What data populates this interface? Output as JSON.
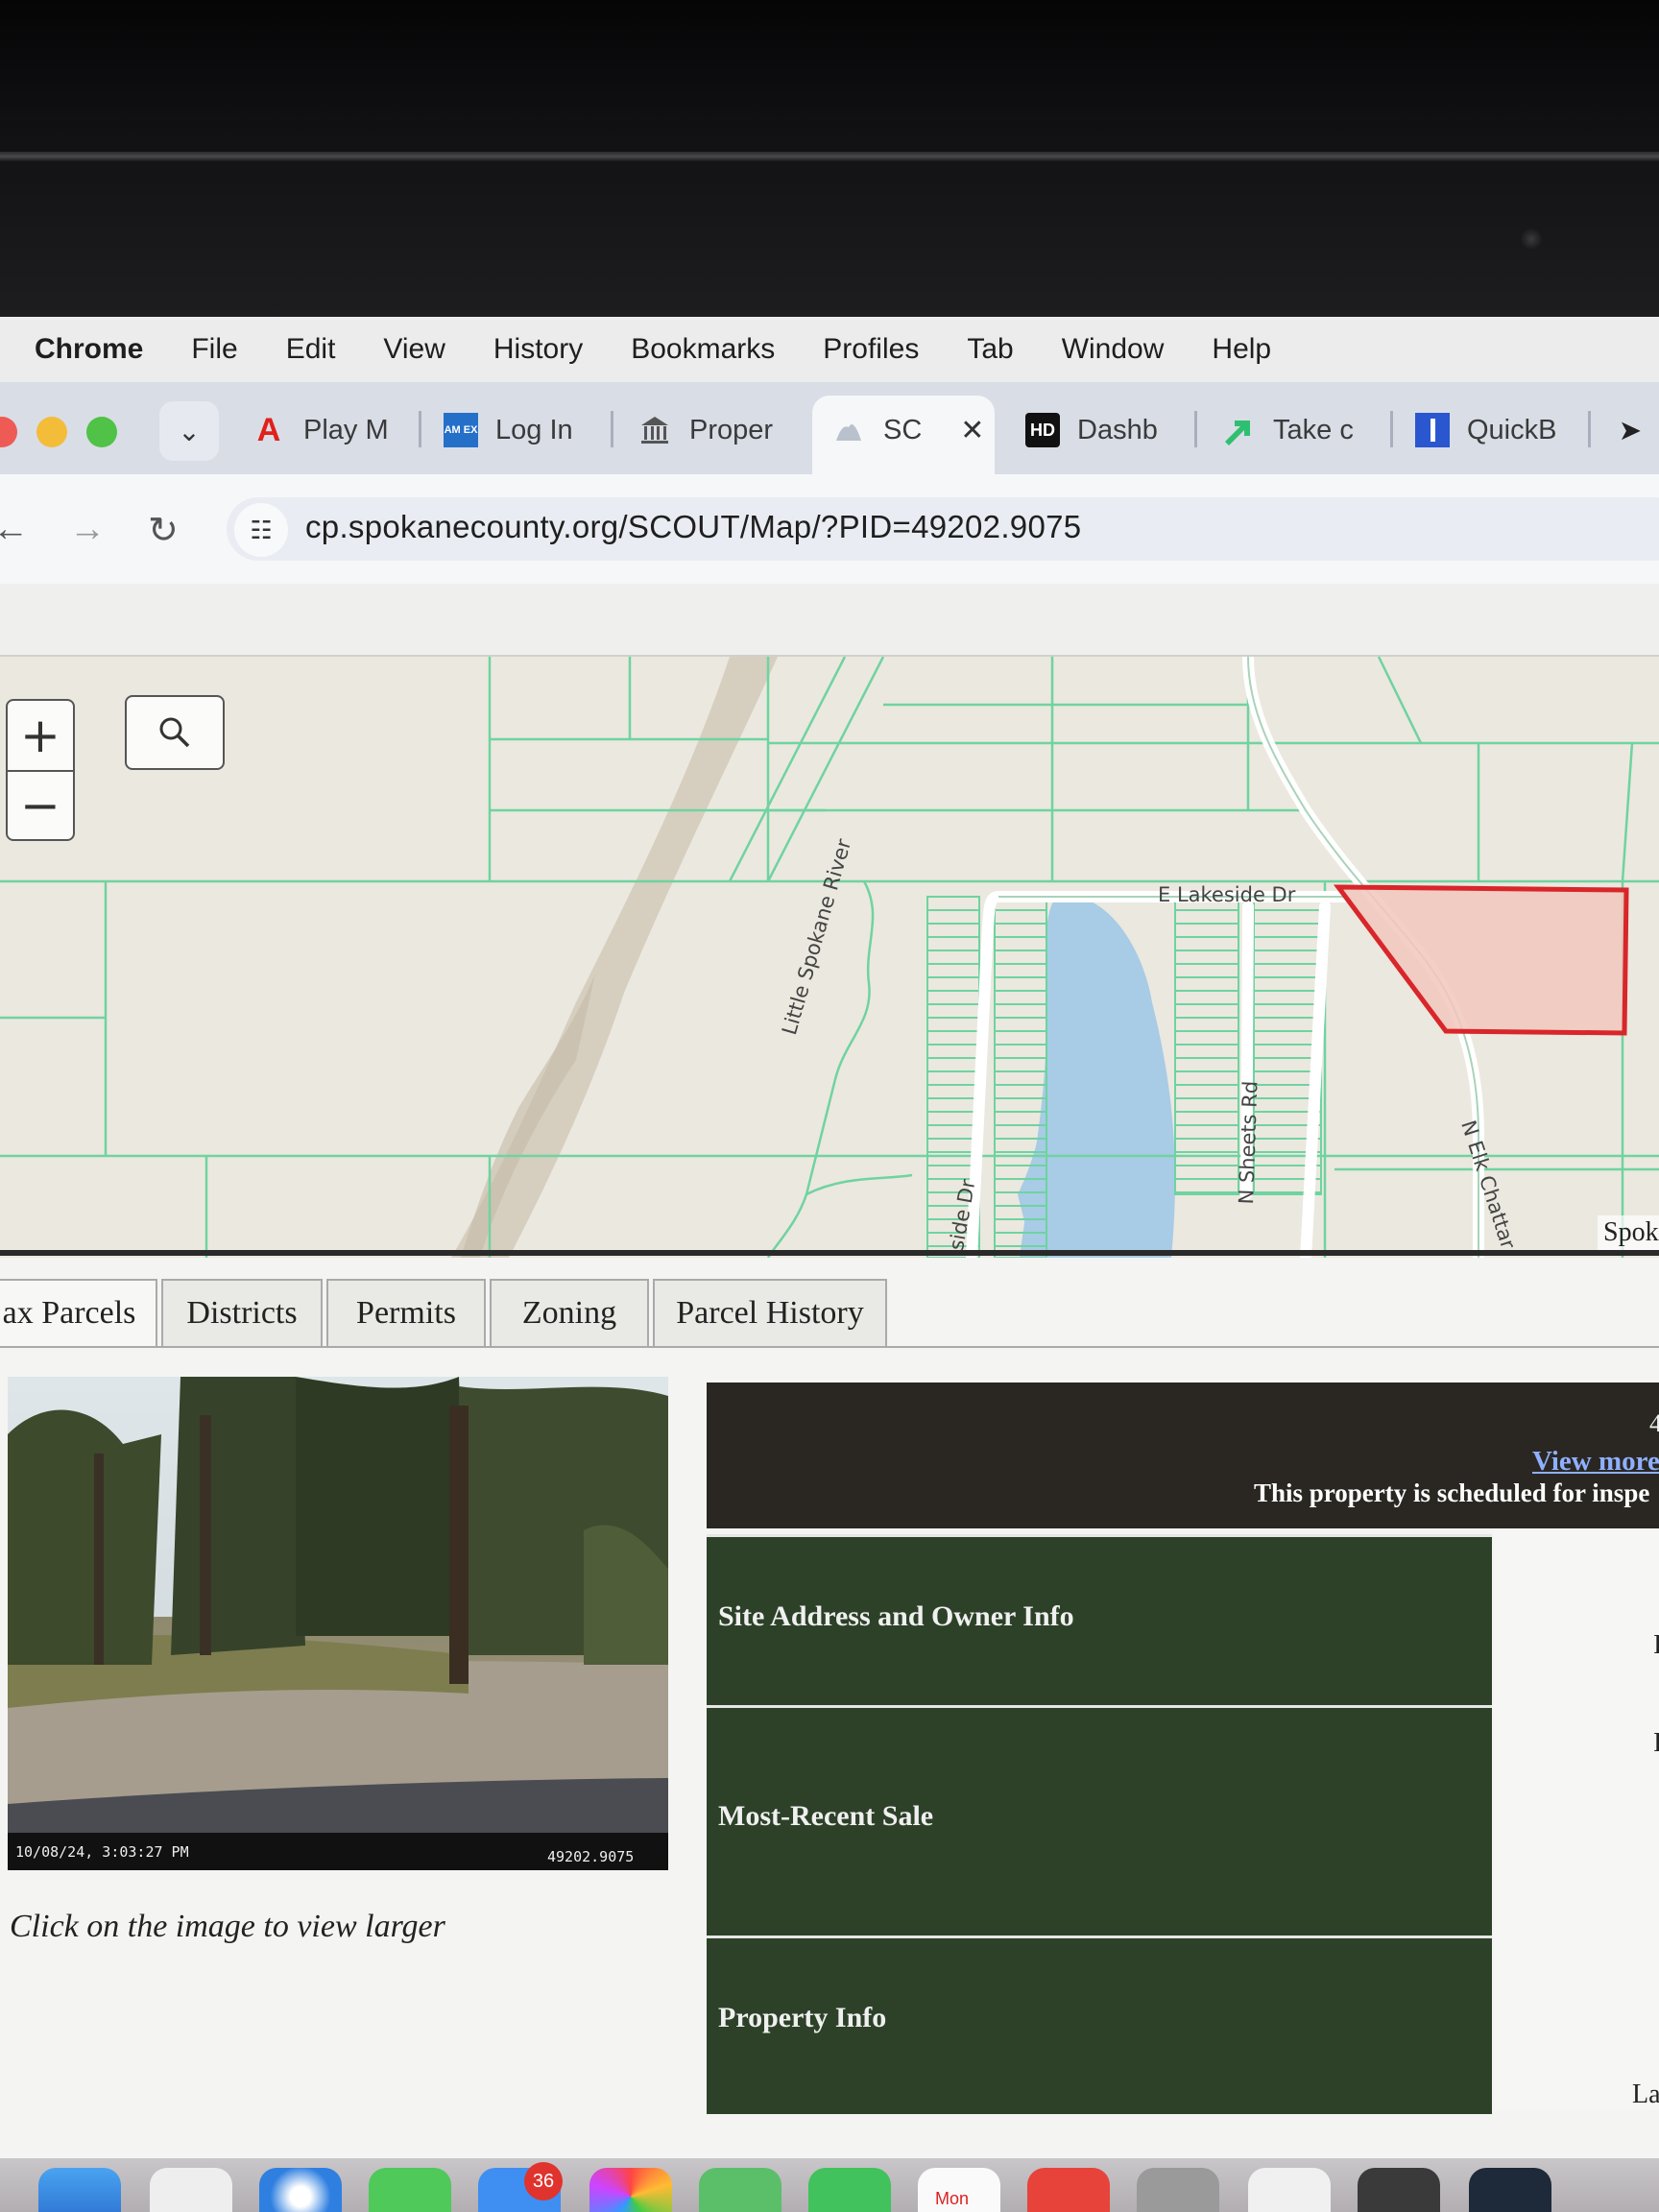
{
  "menubar": {
    "app": "Chrome",
    "items": [
      "File",
      "Edit",
      "View",
      "History",
      "Bookmarks",
      "Profiles",
      "Tab",
      "Window",
      "Help"
    ]
  },
  "tabs": [
    {
      "label": "Play M",
      "icon": "acrobat-icon"
    },
    {
      "label": "Log In",
      "icon": "amex-icon"
    },
    {
      "label": "Proper",
      "icon": "courthouse-icon"
    },
    {
      "label": "SC",
      "icon": "scout-icon",
      "active": true
    },
    {
      "label": "Dashb",
      "icon": "hd-icon"
    },
    {
      "label": "Take c",
      "icon": "arrow-logo-icon"
    },
    {
      "label": "QuickB",
      "icon": "quickbooks-icon"
    }
  ],
  "hd_icon_text": "HD",
  "amex_icon_text": "AM EX",
  "address": {
    "url": "cp.spokanecounty.org/SCOUT/Map/?PID=49202.9075"
  },
  "map": {
    "labels": {
      "lakeside": "E Lakeside Dr",
      "river": "Little Spokane River",
      "sheets": "N Sheets Rd",
      "side": "side Dr",
      "elk": "N Elk Chattar",
      "attribution": "Spok"
    },
    "colors": {
      "parcel_line": "#6fd3a0",
      "water": "#a8cbe6",
      "selected_fill": "#f2c7bd",
      "selected_stroke": "#d8262a"
    }
  },
  "controls": {
    "zoom_in": "+",
    "zoom_out": "−"
  },
  "parcel_tabs": [
    "ax Parcels",
    "Districts",
    "Permits",
    "Zoning",
    "Parcel History"
  ],
  "photo": {
    "timestamp": "10/08/24, 3:03:27 PM",
    "parcel_id": "49202.9075",
    "caption": "Click on the image to view larger"
  },
  "info": {
    "header_number": "4",
    "view_more": "View more",
    "scheduled": "This property is scheduled for inspe",
    "sections": [
      "Site Address and Owner Info",
      "Most-Recent Sale",
      "Property Info"
    ],
    "right_marks": [
      "I",
      "I",
      "La"
    ]
  },
  "dock": {
    "badge": "36",
    "calendar_label": "Mon"
  }
}
